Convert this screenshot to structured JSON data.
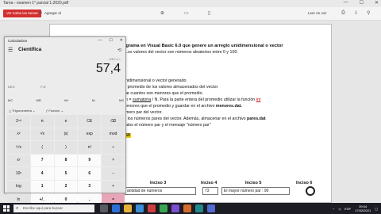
{
  "browser": {
    "tab_title": "Tarea - examen 1° parcial 1.2020.pdf",
    "window_controls": [
      "—",
      "☐",
      "✕"
    ],
    "pdf_button": "Ver todas las tareas",
    "annotate_button": "Agregar al",
    "share_label": "Leer en voz",
    "page_indicator": "1 de 1"
  },
  "document": {
    "lines": {
      "l1": "ograma en Visual Basic 6.0 que genere un arreglo unidimensional o vector",
      "l2": ". Los valores del vector son números aleatorios entre 0 y 100.",
      "l3": "unidimensional o vector generado.",
      "l4": "el promedio de los valores almacenados del vector.",
      "l5": "trar cuantos son menores que el promedio.",
      "l6a": "ón = ",
      "l6b": "sumatoria",
      "l6c": " / N.  Para la parte entera del promedio utilizar la función ",
      "l6d": "int",
      "l7a": "menores que el promedio y guardar en el archivo ",
      "l7b": "menores.dat.",
      "l8": "úmero par del vector.",
      "l9a": "lo los números pares del vector.  Además, almacenar en el archivo ",
      "l9b": "pares.dat",
      "l10": "datos el número par y el mensaje \"número par\"",
      "highlight": "60"
    },
    "table": {
      "headers": [
        "Inciso 3",
        "Inciso 4",
        "Inciso 5",
        "Inciso 6"
      ],
      "row": [
        "antidad de números",
        "73",
        "El mayor número par : 90"
      ]
    }
  },
  "calculator": {
    "title": "Calculadora",
    "mode": "Científica",
    "expression": "0/57,4 =",
    "display": "57,4",
    "memory_row": [
      "DEG",
      "F-E",
      "",
      "",
      ""
    ],
    "memory2_row": [
      "MC",
      "MR",
      "M+",
      "M-",
      "MS"
    ],
    "trig_label": "Trigonometría",
    "func_label": "Función",
    "keys": [
      [
        "2ⁿᵈ",
        "π",
        "e",
        "CE",
        "⌫"
      ],
      [
        "x²",
        "¹/x",
        "|x|",
        "exp",
        "mod"
      ],
      [
        "²√x",
        "(",
        ")",
        "n!",
        "÷"
      ],
      [
        "xʸ",
        "7",
        "8",
        "9",
        "×"
      ],
      [
        "10ˣ",
        "4",
        "5",
        "6",
        "−"
      ],
      [
        "log",
        "1",
        "2",
        "3",
        "+"
      ],
      [
        "ln",
        "+/_",
        "0",
        ",",
        "="
      ]
    ]
  },
  "taskbar": {
    "search_placeholder": "Escribe aquí para buscar",
    "time": "09:04",
    "date": "17/02/2021",
    "lang": "ESP"
  },
  "colors": {
    "pdf_button": "#d32f2f",
    "equals_key": "#e7a5b8",
    "highlight": "#f3d100",
    "taskbar": "#1c1c24"
  }
}
